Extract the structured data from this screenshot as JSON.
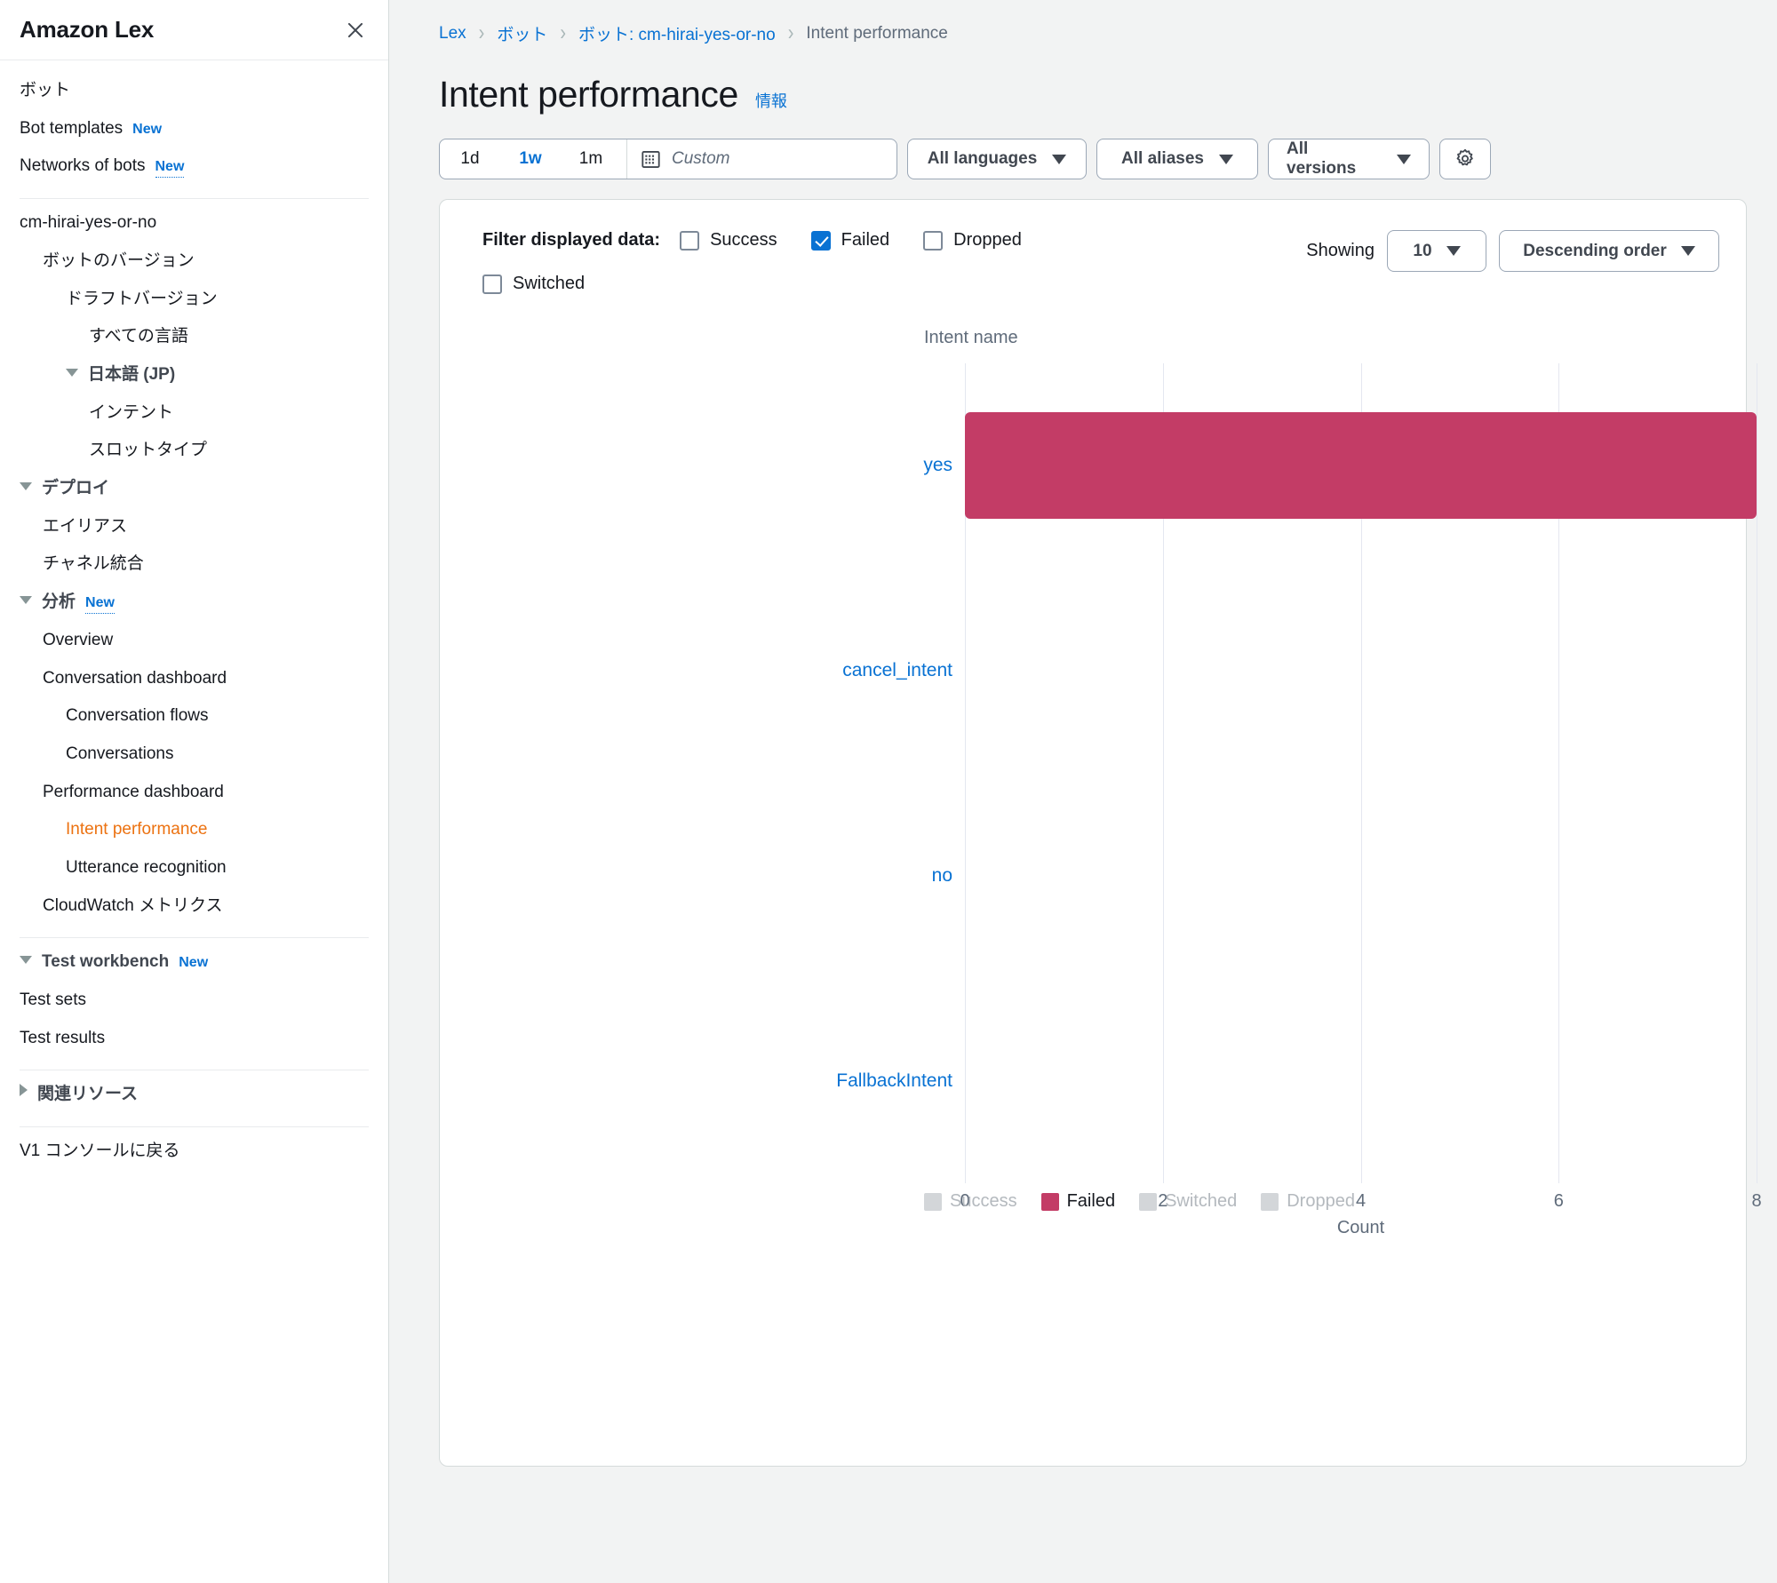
{
  "sidebar": {
    "title": "Amazon Lex",
    "close_icon": "close-icon",
    "items": [
      {
        "label": "ボット",
        "indent": 0,
        "caret": "none",
        "style": "plain"
      },
      {
        "label": "Bot templates",
        "indent": 0,
        "caret": "none",
        "style": "plain",
        "badge": "New"
      },
      {
        "label": "Networks of bots",
        "indent": 0,
        "caret": "none",
        "style": "plain",
        "badge": "New",
        "badge_dotted": true
      },
      {
        "divider": true
      },
      {
        "label": "cm-hirai-yes-or-no",
        "indent": 0,
        "caret": "none",
        "style": "plain"
      },
      {
        "label": "ボットのバージョン",
        "indent": 1,
        "caret": "none",
        "style": "plain"
      },
      {
        "label": "ドラフトバージョン",
        "indent": 2,
        "caret": "none",
        "style": "plain"
      },
      {
        "label": "すべての言語",
        "indent": 3,
        "caret": "none",
        "style": "plain"
      },
      {
        "label": "日本語 (JP)",
        "indent": 2,
        "caret": "down",
        "style": "bold"
      },
      {
        "label": "インテント",
        "indent": 3,
        "caret": "none",
        "style": "plain"
      },
      {
        "label": "スロットタイプ",
        "indent": 3,
        "caret": "none",
        "style": "plain"
      },
      {
        "label": "デプロイ",
        "indent": 0,
        "caret": "down",
        "style": "bold"
      },
      {
        "label": "エイリアス",
        "indent": 1,
        "caret": "none",
        "style": "plain"
      },
      {
        "label": "チャネル統合",
        "indent": 1,
        "caret": "none",
        "style": "plain"
      },
      {
        "label": "分析",
        "indent": 0,
        "caret": "down",
        "style": "bold",
        "badge": "New",
        "badge_dotted": true
      },
      {
        "label": "Overview",
        "indent": 1,
        "caret": "none",
        "style": "plain"
      },
      {
        "label": "Conversation dashboard",
        "indent": 1,
        "caret": "none",
        "style": "plain"
      },
      {
        "label": "Conversation flows",
        "indent": 2,
        "caret": "none",
        "style": "plain"
      },
      {
        "label": "Conversations",
        "indent": 2,
        "caret": "none",
        "style": "plain"
      },
      {
        "label": "Performance dashboard",
        "indent": 1,
        "caret": "none",
        "style": "plain"
      },
      {
        "label": "Intent performance",
        "indent": 2,
        "caret": "none",
        "style": "active"
      },
      {
        "label": "Utterance recognition",
        "indent": 2,
        "caret": "none",
        "style": "plain"
      },
      {
        "label": "CloudWatch メトリクス",
        "indent": 1,
        "caret": "none",
        "style": "plain"
      },
      {
        "divider": true
      },
      {
        "label": "Test workbench",
        "indent": 0,
        "caret": "down",
        "style": "bold",
        "badge": "New"
      },
      {
        "label": "Test sets",
        "indent": 0,
        "caret": "none",
        "style": "plain"
      },
      {
        "label": "Test results",
        "indent": 0,
        "caret": "none",
        "style": "plain"
      },
      {
        "divider": true
      },
      {
        "label": "関連リソース",
        "indent": 0,
        "caret": "right",
        "style": "bold"
      },
      {
        "divider": true
      },
      {
        "label": "V1 コンソールに戻る",
        "indent": 0,
        "caret": "none",
        "style": "plain"
      }
    ]
  },
  "breadcrumb": [
    {
      "label": "Lex",
      "current": false
    },
    {
      "label": "ボット",
      "current": false
    },
    {
      "label": "ボット: cm-hirai-yes-or-no",
      "current": false
    },
    {
      "label": "Intent performance",
      "current": true
    }
  ],
  "page": {
    "title": "Intent performance",
    "info_label": "情報"
  },
  "toolbar": {
    "ranges": [
      {
        "label": "1d",
        "active": false
      },
      {
        "label": "1w",
        "active": true
      },
      {
        "label": "1m",
        "active": false
      }
    ],
    "custom_placeholder": "Custom",
    "calendar_icon": "calendar-icon",
    "dropdowns": [
      {
        "label": "All languages",
        "key": "langs"
      },
      {
        "label": "All aliases",
        "key": "aliases"
      },
      {
        "label": "All versions",
        "key": "versions"
      }
    ],
    "settings_icon": "gear-icon"
  },
  "filters": {
    "label": "Filter displayed data:",
    "options": [
      {
        "label": "Success",
        "checked": false
      },
      {
        "label": "Failed",
        "checked": true
      },
      {
        "label": "Dropped",
        "checked": false
      }
    ],
    "switched": {
      "label": "Switched",
      "checked": false
    },
    "showing_label": "Showing",
    "showing_count": "10",
    "sort_order": "Descending order"
  },
  "colors": {
    "failed": "#c33c66",
    "accent_blue": "#0972d3",
    "active_orange": "#ec7211",
    "muted": "#d3d6d9"
  },
  "chart_data": {
    "type": "bar",
    "orientation": "horizontal",
    "title": "",
    "xlabel": "Count",
    "ylabel": "Intent name",
    "categories": [
      "yes",
      "cancel_intent",
      "no",
      "FallbackIntent"
    ],
    "series": [
      {
        "name": "Success",
        "values": [
          0,
          0,
          0,
          0
        ],
        "color": "#d3d6d9",
        "visible": false
      },
      {
        "name": "Failed",
        "values": [
          8,
          0,
          0,
          0
        ],
        "color": "#c33c66",
        "visible": true
      },
      {
        "name": "Switched",
        "values": [
          0,
          0,
          0,
          0
        ],
        "color": "#d3d6d9",
        "visible": false
      },
      {
        "name": "Dropped",
        "values": [
          0,
          0,
          0,
          0
        ],
        "color": "#d3d6d9",
        "visible": false
      }
    ],
    "xlim": [
      0,
      8
    ],
    "xticks": [
      0,
      2,
      4,
      6,
      8
    ],
    "grid": true,
    "legend": [
      {
        "label": "Success",
        "active": false
      },
      {
        "label": "Failed",
        "active": true
      },
      {
        "label": "Switched",
        "active": false
      },
      {
        "label": "Dropped",
        "active": false
      }
    ],
    "legend_position": "bottom-left"
  }
}
